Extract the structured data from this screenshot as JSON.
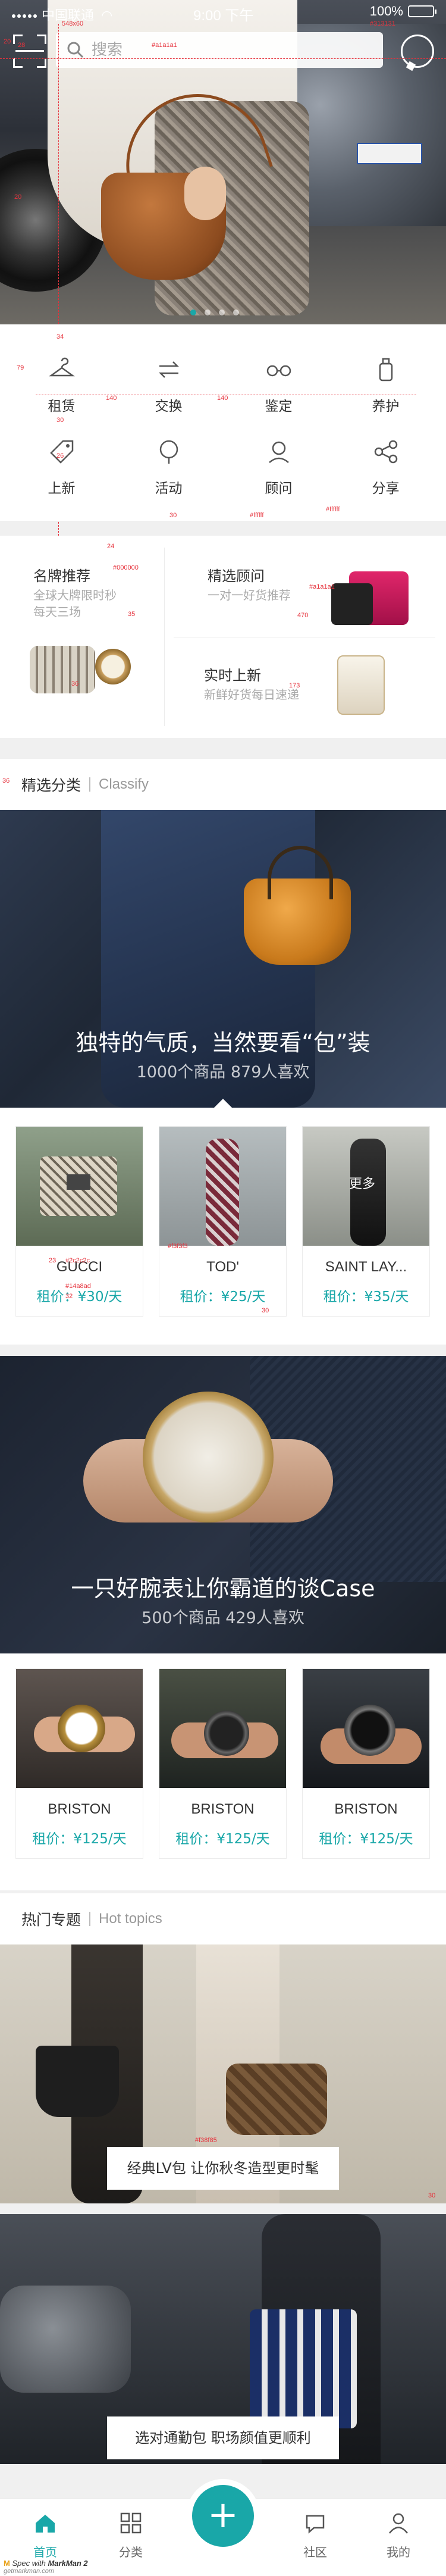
{
  "status_bar": {
    "carrier": "中国联通",
    "time": "9:00 下午",
    "battery": "100%"
  },
  "search": {
    "placeholder": "搜索"
  },
  "carousel": {
    "pages": 4,
    "active": 1
  },
  "quick_menu": [
    {
      "label": "租赁",
      "icon": "hanger-icon"
    },
    {
      "label": "交换",
      "icon": "exchange-icon"
    },
    {
      "label": "鉴定",
      "icon": "glasses-icon"
    },
    {
      "label": "养护",
      "icon": "bottle-icon"
    },
    {
      "label": "上新",
      "icon": "tag-icon"
    },
    {
      "label": "活动",
      "icon": "balloon-icon"
    },
    {
      "label": "顾问",
      "icon": "advisor-icon"
    },
    {
      "label": "分享",
      "icon": "share-icon"
    }
  ],
  "promo": {
    "brand": {
      "title": "名牌推荐",
      "sub1": "全球大牌限时秒",
      "sub2": "每天三场"
    },
    "advisor": {
      "title": "精选顾问",
      "sub": "一对一好货推荐"
    },
    "new": {
      "title": "实时上新",
      "sub": "新鲜好货每日速递"
    }
  },
  "classify": {
    "title": "精选分类",
    "en": "Classify"
  },
  "banner1": {
    "caption": "独特的气质，当然要看“包”装",
    "stats": "1000个商品 879人喜欢"
  },
  "row1": [
    {
      "name": "GUCCI",
      "price": "租价：¥30/天"
    },
    {
      "name": "TOD'",
      "price": "租价：¥25/天"
    },
    {
      "name": "SAINT LAY...",
      "price": "租价：¥35/天",
      "badge": "更多"
    }
  ],
  "banner2": {
    "caption": "一只好腕表让你霸道的谈Case",
    "stats": "500个商品 429人喜欢"
  },
  "row2": [
    {
      "name": "BRISTON",
      "price": "租价：¥125/天"
    },
    {
      "name": "BRISTON",
      "price": "租价：¥125/天"
    },
    {
      "name": "BRISTON",
      "price": "租价：¥125/天"
    }
  ],
  "hot": {
    "title": "热门专题",
    "en": "Hot topics"
  },
  "topics": [
    {
      "caption": "经典LV包 让你秋冬造型更时髦"
    },
    {
      "caption": "选对通勤包 职场颜值更顺利"
    }
  ],
  "tabbar": [
    {
      "label": "首页",
      "active": true
    },
    {
      "label": "分类"
    },
    {
      "label": "社区"
    },
    {
      "label": "我的"
    }
  ],
  "fab": "+",
  "spec": {
    "brand_note": "Spec with",
    "brand_name": "MarkMan 2",
    "site": "getmarkman.com",
    "color1": "#a1a1a1",
    "color2": "#313131",
    "size1": "548x60",
    "n20": "20",
    "n28": "28",
    "n34": "34",
    "n79": "79",
    "n140": "140",
    "n30": "30",
    "n26": "26",
    "n36": "36",
    "n24": "24",
    "colorA": "#ffffff",
    "colorB": "#000000",
    "colorC": "#a1a1a1",
    "n35": "35",
    "n470": "470",
    "n173": "173",
    "n122": "122",
    "n340": "340",
    "colorD": "#2c2c2c",
    "colorE": "#14a8ad",
    "colorF": "#f3f3f3",
    "colorG": "#8d8d8d",
    "colorH": "#fff",
    "n23": "23",
    "n32": "32",
    "n348": "348",
    "n356": "356",
    "n158": "158",
    "colorI": "#f38f85",
    "n15": "15",
    "n212": "212",
    "n40": "40"
  }
}
